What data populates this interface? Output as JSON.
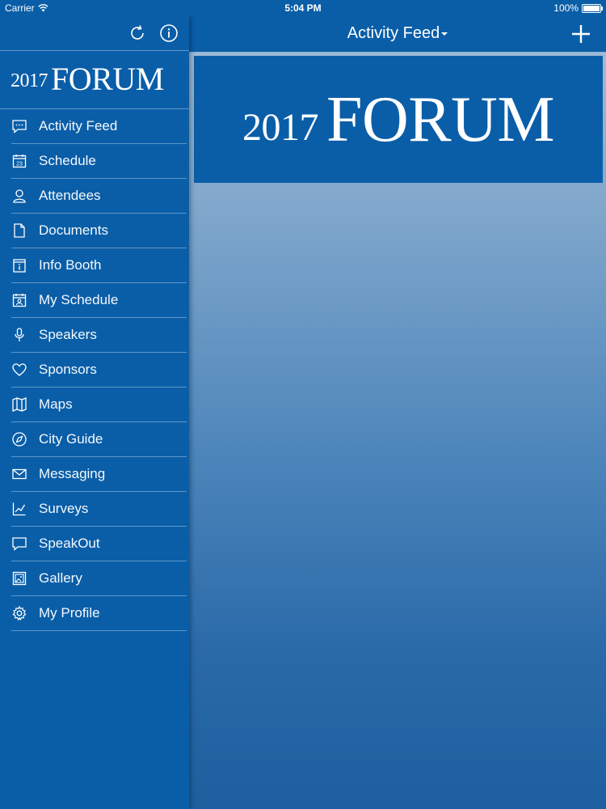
{
  "status_bar": {
    "carrier": "Carrier",
    "time": "5:04 PM",
    "battery": "100%"
  },
  "header": {
    "title": "Activity Feed"
  },
  "logo": {
    "year": "2017",
    "word": "FORUM"
  },
  "sidebar": {
    "items": [
      {
        "label": "Activity Feed",
        "icon": "chat-bubble-icon"
      },
      {
        "label": "Schedule",
        "icon": "calendar-icon"
      },
      {
        "label": "Attendees",
        "icon": "person-icon"
      },
      {
        "label": "Documents",
        "icon": "document-icon"
      },
      {
        "label": "Info Booth",
        "icon": "info-booth-icon"
      },
      {
        "label": "My Schedule",
        "icon": "my-schedule-icon"
      },
      {
        "label": "Speakers",
        "icon": "microphone-icon"
      },
      {
        "label": "Sponsors",
        "icon": "heart-icon"
      },
      {
        "label": "Maps",
        "icon": "map-icon"
      },
      {
        "label": "City Guide",
        "icon": "compass-icon"
      },
      {
        "label": "Messaging",
        "icon": "envelope-icon"
      },
      {
        "label": "Surveys",
        "icon": "chart-icon"
      },
      {
        "label": "SpeakOut",
        "icon": "speech-bubble-icon"
      },
      {
        "label": "Gallery",
        "icon": "gallery-icon"
      },
      {
        "label": "My Profile",
        "icon": "gear-icon"
      }
    ]
  },
  "colors": {
    "primary": "#0a5ea8",
    "text": "#ffffff"
  }
}
